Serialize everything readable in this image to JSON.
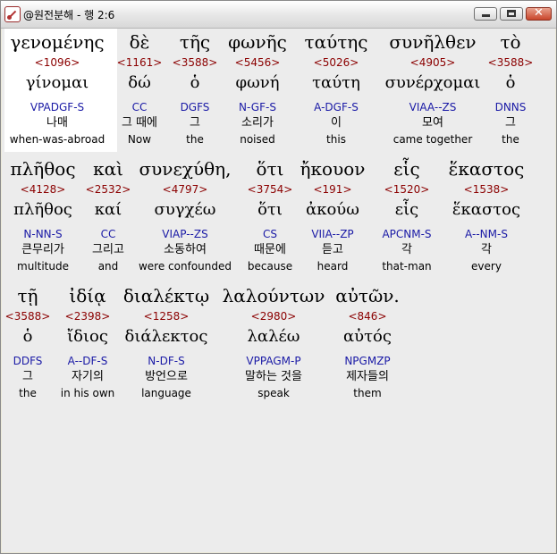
{
  "window": {
    "title": "@원전분해 - 행 2:6"
  },
  "controls": {
    "minimize": "_",
    "maximize": "□",
    "close": "✕"
  },
  "tokens": [
    {
      "greek": "γενομένης",
      "strong": "<1096>",
      "lemma": "γίνομαι",
      "morph": "VPADGF-S",
      "korean": "나매",
      "english": "when-was-abroad"
    },
    {
      "greek": "δὲ",
      "strong": "<1161>",
      "lemma": "δώ",
      "morph": "CC",
      "korean": "그 때에",
      "english": "Now"
    },
    {
      "greek": "τῆς",
      "strong": "<3588>",
      "lemma": "ὁ",
      "morph": "DGFS",
      "korean": "그",
      "english": "the"
    },
    {
      "greek": "φωνῆς",
      "strong": "<5456>",
      "lemma": "φωνή",
      "morph": "N-GF-S",
      "korean": "소리가",
      "english": "noised"
    },
    {
      "greek": "ταύτης",
      "strong": "<5026>",
      "lemma": "ταύτη",
      "morph": "A-DGF-S",
      "korean": "이",
      "english": "this"
    },
    {
      "greek": "συνῆλθεν",
      "strong": "<4905>",
      "lemma": "συνέρχομαι",
      "morph": "VIAA--ZS",
      "korean": "모여",
      "english": "came together"
    },
    {
      "greek": "τὸ",
      "strong": "<3588>",
      "lemma": "ὁ",
      "morph": "DNNS",
      "korean": "그",
      "english": "the"
    },
    {
      "greek": "πλῆθος",
      "strong": "<4128>",
      "lemma": "πλῆθος",
      "morph": "N-NN-S",
      "korean": "큰무리가",
      "english": "multitude"
    },
    {
      "greek": "καὶ",
      "strong": "<2532>",
      "lemma": "καί",
      "morph": "CC",
      "korean": "그리고",
      "english": "and"
    },
    {
      "greek": "συνεχύθη,",
      "strong": "<4797>",
      "lemma": "συγχέω",
      "morph": "VIAP--ZS",
      "korean": "소동하여",
      "english": "were confounded"
    },
    {
      "greek": "ὅτι",
      "strong": "<3754>",
      "lemma": "ὅτι",
      "morph": "CS",
      "korean": "때문에",
      "english": "because"
    },
    {
      "greek": "ἤκουον",
      "strong": "<191>",
      "lemma": "ἀκούω",
      "morph": "VIIA--ZP",
      "korean": "듣고",
      "english": "heard"
    },
    {
      "greek": "εἷς",
      "strong": "<1520>",
      "lemma": "εἷς",
      "morph": "APCNM-S",
      "korean": "각",
      "english": "that-man"
    },
    {
      "greek": "ἕκαστος",
      "strong": "<1538>",
      "lemma": "ἕκαστος",
      "morph": "A--NM-S",
      "korean": "각",
      "english": "every"
    },
    {
      "greek": "τῇ",
      "strong": "<3588>",
      "lemma": "ὁ",
      "morph": "DDFS",
      "korean": "그",
      "english": "the"
    },
    {
      "greek": "ἰδίᾳ",
      "strong": "<2398>",
      "lemma": "ἴδιος",
      "morph": "A--DF-S",
      "korean": "자기의",
      "english": "in his own"
    },
    {
      "greek": "διαλέκτῳ",
      "strong": "<1258>",
      "lemma": "διάλεκτος",
      "morph": "N-DF-S",
      "korean": "방언으로",
      "english": "language"
    },
    {
      "greek": "λαλούντων",
      "strong": "<2980>",
      "lemma": "λαλέω",
      "morph": "VPPAGM-P",
      "korean": "말하는 것을",
      "english": "speak"
    },
    {
      "greek": "αὐτῶν.",
      "strong": "<846>",
      "lemma": "αὐτός",
      "morph": "NPGMZP",
      "korean": "제자들의",
      "english": "them"
    }
  ],
  "colors": {
    "strong": "#8b0000",
    "morph": "#1a1aa6",
    "selected_bg": "#ffffff",
    "content_bg": "#ececec"
  }
}
